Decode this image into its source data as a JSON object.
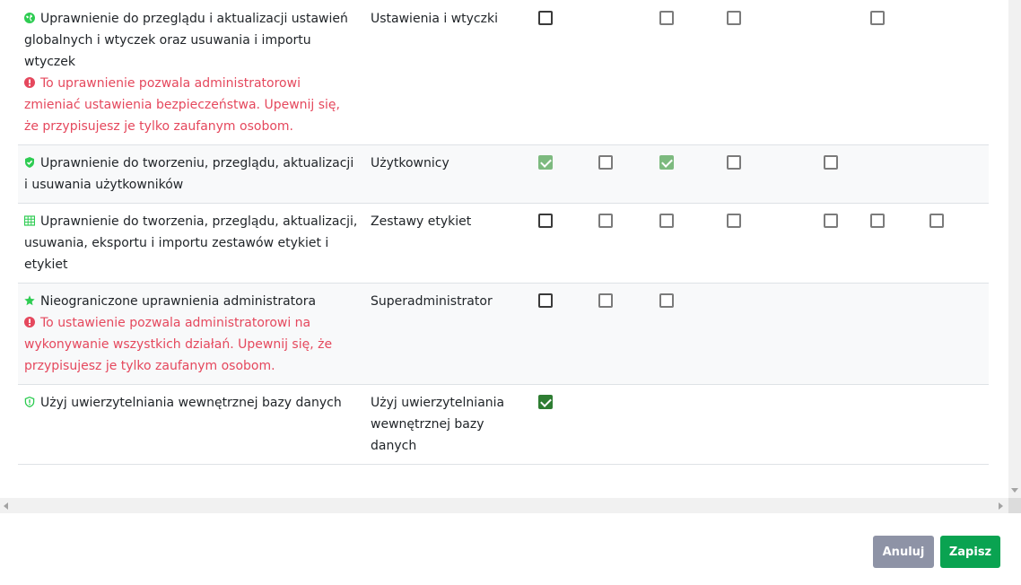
{
  "permissions": [
    {
      "icon": "globe-icon",
      "label": "Uprawnienie do przeglądu i aktualizacji ustawień globalnych i wtyczek oraz usuwania i importu wtyczek",
      "warning": "To uprawnienie pozwala administratorowi zmieniać ustawienia bezpieczeństwa. Upewnij się, że przypisujesz je tylko zaufanym osobom.",
      "category": "Ustawienia i wtyczki",
      "checkboxes": [
        "unchecked",
        null,
        "unchecked",
        "unchecked",
        null,
        "unchecked",
        null
      ]
    },
    {
      "icon": "shield-check-icon",
      "label": "Uprawnienie do tworzeniu, przeglądu, aktualizacji i usuwania użytkowników",
      "warning": "",
      "category": "Użytkownicy",
      "checkboxes": [
        "checked-disabled",
        "unchecked",
        "checked-disabled",
        "unchecked",
        "unchecked",
        null,
        null
      ]
    },
    {
      "icon": "grid-icon",
      "label": "Uprawnienie do tworzenia, przeglądu, aktualizacji, usuwania, eksportu i importu zestawów etykiet i etykiet",
      "warning": "",
      "category": "Zestawy etykiet",
      "checkboxes": [
        "unchecked",
        "unchecked",
        "unchecked",
        "unchecked",
        "unchecked",
        "unchecked",
        "unchecked"
      ]
    },
    {
      "icon": "star-icon",
      "label": "Nieograniczone uprawnienia administratora",
      "warning": "To ustawienie pozwala administratorowi na wykonywanie wszystkich działań. Upewnij się, że przypisujesz je tylko zaufanym osobom.",
      "category": "Superadministrator",
      "checkboxes": [
        "unchecked",
        "unchecked",
        "unchecked",
        null,
        null,
        null,
        null
      ]
    },
    {
      "icon": "shield-exclamation-icon",
      "label": "Użyj uwierzytelniania wewnętrznej bazy danych",
      "warning": "",
      "category": "Użyj uwierzytelniania wewnętrznej bazy danych",
      "checkboxes": [
        "checked",
        null,
        null,
        null,
        null,
        null,
        null
      ]
    }
  ],
  "footer": {
    "cancel_label": "Anuluj",
    "save_label": "Zapisz"
  },
  "colors": {
    "icon_green": "#2ecc52",
    "warning_red": "#e5485d",
    "save_button": "#0aa351",
    "cancel_button": "#8e93a6"
  }
}
